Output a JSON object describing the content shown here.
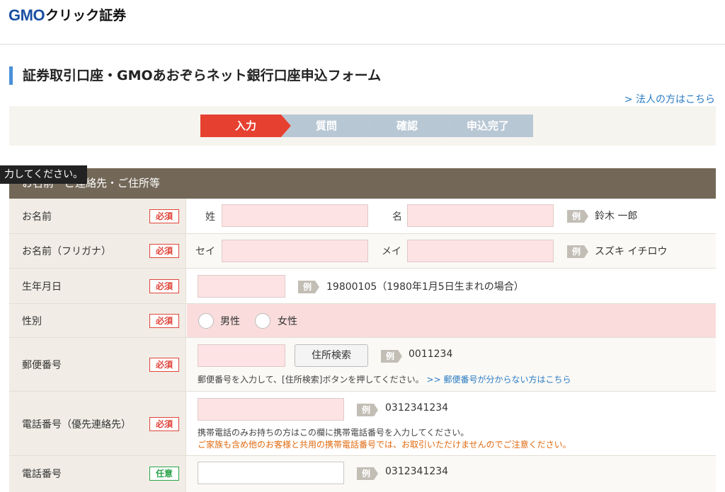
{
  "header": {
    "logo_gmo": "GMO",
    "logo_ja": "クリック証券"
  },
  "page": {
    "title": "証券取引口座・GMOあおぞらネット銀行口座申込フォーム",
    "corp_link": "> 法人の方はこちら"
  },
  "steps": [
    {
      "label": "入力",
      "active": true
    },
    {
      "label": "質問",
      "active": false
    },
    {
      "label": "確認",
      "active": false
    },
    {
      "label": "申込完了",
      "active": false
    }
  ],
  "tooltip": "力してください。",
  "section": {
    "title": "お名前・ご連絡先・ご住所等"
  },
  "badges": {
    "required": "必須",
    "optional": "任意",
    "example": "例"
  },
  "rows": {
    "name": {
      "label": "お名前",
      "last_label": "姓",
      "first_label": "名",
      "last_value": "",
      "first_value": "",
      "example": "鈴木 一郎"
    },
    "kana": {
      "label": "お名前（フリガナ）",
      "last_label": "セイ",
      "first_label": "メイ",
      "last_value": "",
      "first_value": "",
      "example": "スズキ イチロウ"
    },
    "birth": {
      "label": "生年月日",
      "value": "",
      "example": "19800105（1980年1月5日生まれの場合）"
    },
    "gender": {
      "label": "性別",
      "male": "男性",
      "female": "女性"
    },
    "postal": {
      "label": "郵便番号",
      "value": "",
      "button": "住所検索",
      "example": "0011234",
      "note": "郵便番号を入力して、[住所検索]ボタンを押してください。",
      "note_link": ">> 郵便番号が分からない方はこちら"
    },
    "phone_primary": {
      "label": "電話番号（優先連絡先）",
      "value": "",
      "example": "0312341234",
      "note": "携帯電話のみお持ちの方はこの欄に携帯電話番号を入力してください。",
      "warning": "ご家族も含め他のお客様と共用の携帯電話番号では、お取引いただけませんのでご注意ください。"
    },
    "phone": {
      "label": "電話番号",
      "value": "",
      "example": "0312341234"
    }
  }
}
